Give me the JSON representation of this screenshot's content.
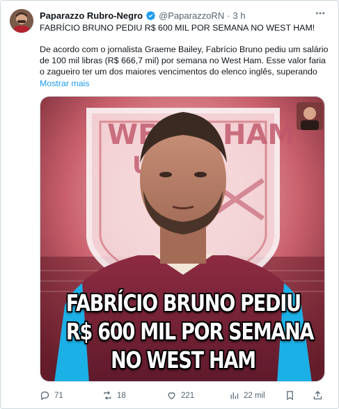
{
  "tweet": {
    "author_name": "Paparazzo Rubro-Negro",
    "handle": "@PaparazzoRN",
    "separator": "·",
    "time": "3 h",
    "more_icon": "more-horizontal-icon",
    "headline": "FABRÍCIO BRUNO PEDIU R$ 600 MIL POR SEMANA NO WEST HAM!",
    "body": "De acordo com o jornalista Graeme Bailey, Fabrício Bruno pediu um salário de 100 mil libras (R$ 666,7 mil) por semana no West Ham. Esse valor faria o zagueiro ter um dos maiores vencimentos do elenco inglês, superando",
    "show_more": "Mostrar mais",
    "accent_color": "#1d9bf0"
  },
  "media": {
    "crest_text_top": "WEST",
    "crest_text_right": "HAM",
    "crest_text_left": "U",
    "caption_line1": "FABRÍCIO BRUNO PEDIU",
    "caption_line2": "R$ 600 MIL POR SEMANA",
    "caption_line3": "NO WEST HAM",
    "shirt_color": "#7a263a",
    "sleeve_color": "#1bb1e7"
  },
  "actions": {
    "reply_count": "71",
    "retweet_count": "18",
    "like_count": "221",
    "views_count": "22 mil",
    "icons": [
      "reply-icon",
      "retweet-icon",
      "like-icon",
      "views-icon",
      "bookmark-icon",
      "share-icon"
    ]
  }
}
